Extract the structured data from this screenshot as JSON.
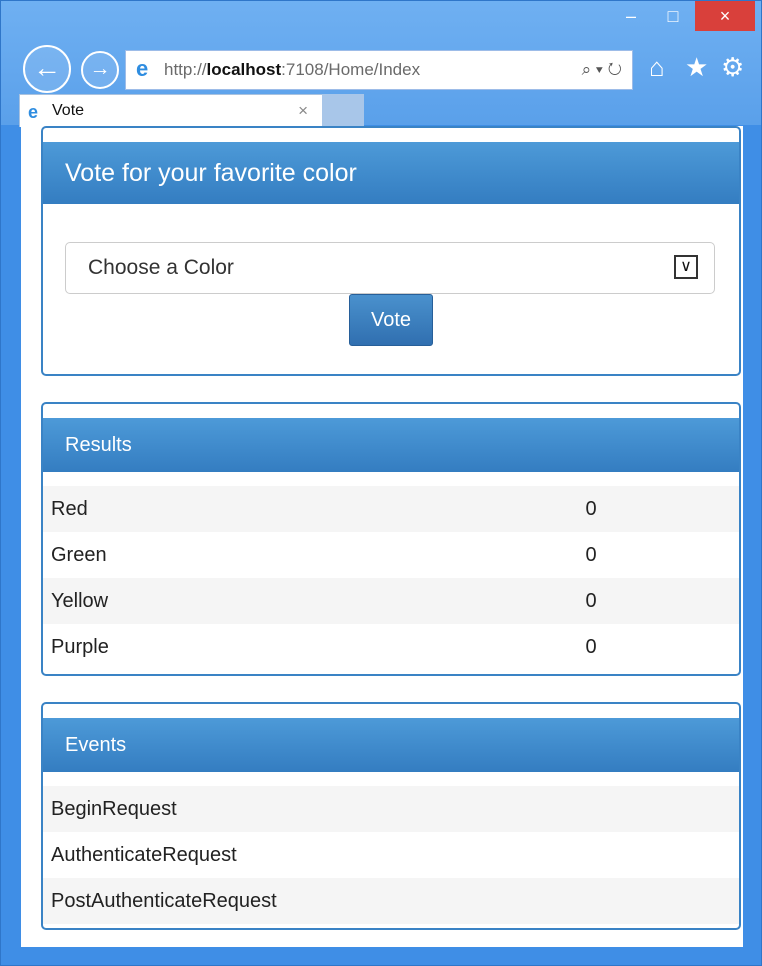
{
  "browser": {
    "window": {
      "minimize": "–",
      "maximize": "□",
      "close": "×"
    },
    "nav": {
      "back": "←",
      "forward": "→"
    },
    "address": {
      "prefix": "http://",
      "host": "localhost",
      "rest": ":7108/Home/Index",
      "tools": "⌕ ▾ ↻"
    },
    "toolbar": {
      "home": "⌂",
      "favorites": "★",
      "settings": "⚙"
    },
    "tab": {
      "title": "Vote",
      "close": "×"
    }
  },
  "page": {
    "vote_panel": {
      "title": "Vote for your favorite color",
      "select_value": "Choose a Color",
      "button": "Vote"
    },
    "results": {
      "title": "Results",
      "rows": [
        {
          "color": "Red",
          "count": "0"
        },
        {
          "color": "Green",
          "count": "0"
        },
        {
          "color": "Yellow",
          "count": "0"
        },
        {
          "color": "Purple",
          "count": "0"
        }
      ]
    },
    "events": {
      "title": "Events",
      "rows": [
        "BeginRequest",
        "AuthenticateRequest",
        "PostAuthenticateRequest"
      ]
    }
  }
}
